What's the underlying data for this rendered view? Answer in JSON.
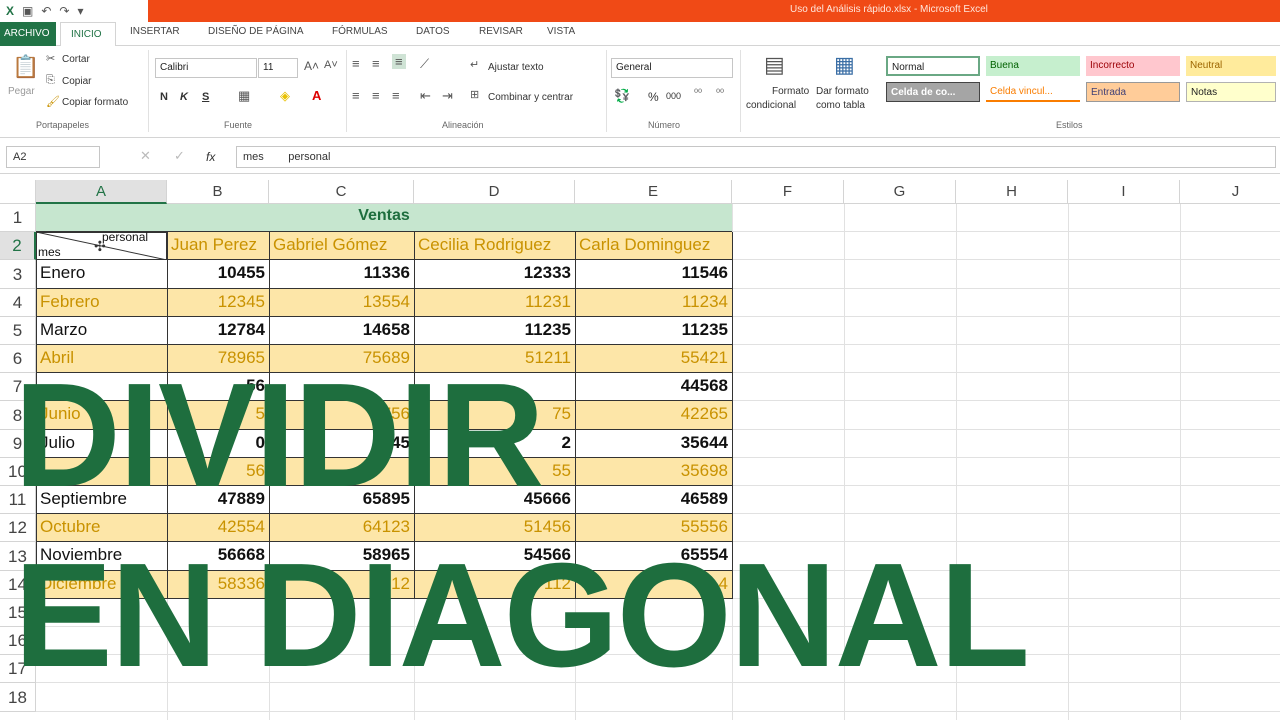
{
  "window": {
    "title": "Uso del Análisis rápido.xlsx - Microsoft Excel"
  },
  "tabs": [
    "ARCHIVO",
    "INICIO",
    "INSERTAR",
    "DISEÑO DE PÁGINA",
    "FÓRMULAS",
    "DATOS",
    "REVISAR",
    "VISTA"
  ],
  "ribbon": {
    "clipboard": {
      "paste": "Pegar",
      "cut": "Cortar",
      "copy": "Copiar",
      "format_painter": "Copiar formato",
      "label": "Portapapeles"
    },
    "font": {
      "name": "Calibri",
      "size": "11",
      "bold": "N",
      "italic": "K",
      "underline": "S",
      "label": "Fuente"
    },
    "alignment": {
      "wrap": "Ajustar texto",
      "merge": "Combinar y centrar",
      "label": "Alineación"
    },
    "number": {
      "format": "General",
      "percent": "%",
      "thousands": "000",
      "label": "Número"
    },
    "styles": {
      "conditional": [
        "Formato",
        "condicional"
      ],
      "as_table": [
        "Dar formato",
        "como tabla"
      ],
      "cells": [
        {
          "name": "Normal",
          "bg": "#ffffff",
          "fg": "#222222"
        },
        {
          "name": "Buena",
          "bg": "#c6efce",
          "fg": "#006100"
        },
        {
          "name": "Incorrecto",
          "bg": "#ffc7ce",
          "fg": "#9c0006"
        },
        {
          "name": "Neutral",
          "bg": "#ffeb9c",
          "fg": "#9c6500"
        },
        {
          "name": "Celda de co...",
          "bg": "#a5a5a5",
          "fg": "#ffffff"
        },
        {
          "name": "Celda vincul...",
          "bg": "#ffffff",
          "fg": "#fa7d00"
        },
        {
          "name": "Entrada",
          "bg": "#ffcc99",
          "fg": "#3f3f76"
        },
        {
          "name": "Notas",
          "bg": "#ffffcc",
          "fg": "#222222"
        }
      ],
      "label": "Estilos"
    }
  },
  "formula_bar": {
    "name_box": "A2",
    "fx": "fx",
    "content": "mes        personal"
  },
  "columns": [
    "A",
    "B",
    "C",
    "D",
    "E",
    "F",
    "G",
    "H",
    "I",
    "J"
  ],
  "rows": [
    "1",
    "2",
    "3",
    "4",
    "5",
    "6",
    "7",
    "8",
    "9",
    "10",
    "11",
    "12",
    "13",
    "14",
    "15",
    "16",
    "17",
    "18"
  ],
  "sheet": {
    "title": "Ventas",
    "diag_top": "personal",
    "diag_bottom": "mes",
    "headers": [
      "Juan Perez",
      "Gabriel Gómez",
      "Cecilia Rodriguez",
      "Carla Dominguez"
    ],
    "data": [
      [
        "Enero",
        "10455",
        "11336",
        "12333",
        "11546"
      ],
      [
        "Febrero",
        "12345",
        "13554",
        "11231",
        "11234"
      ],
      [
        "Marzo",
        "12784",
        "14658",
        "11235",
        "11235"
      ],
      [
        "Abril",
        "78965",
        "75689",
        "51211",
        "55421"
      ],
      [
        "",
        "56",
        "",
        "",
        "44568"
      ],
      [
        "Junio",
        "5",
        "756",
        "75",
        "42265"
      ],
      [
        "Julio",
        "0",
        "845",
        "2",
        "35644"
      ],
      [
        "",
        "56",
        "",
        "55",
        "35698"
      ],
      [
        "Septiembre",
        "47889",
        "65895",
        "45666",
        "46589"
      ],
      [
        "Octubre",
        "42554",
        "64123",
        "51456",
        "55556"
      ],
      [
        "Noviembre",
        "56668",
        "58965",
        "54566",
        "65554"
      ],
      [
        "Diciembre",
        "58336",
        "12",
        "112",
        "4"
      ]
    ]
  },
  "overlay": {
    "line1": "DIVIDIR",
    "line2": "EN DIAGONAL"
  },
  "colors": {
    "excel_green": "#217346",
    "title_red": "#f04a16",
    "header_green": "#c6e6cf",
    "band_yellow": "#fde6a8",
    "orange_text": "#c99200",
    "overlay_green": "#1e6e3e"
  }
}
